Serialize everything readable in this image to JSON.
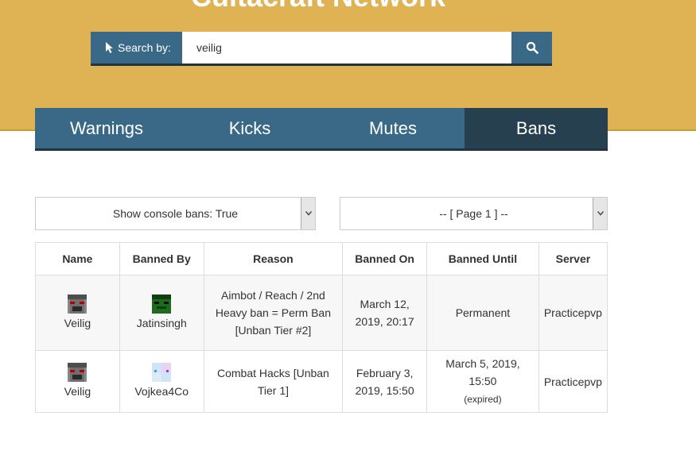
{
  "site": {
    "title": "Cultacraft Network"
  },
  "search": {
    "label": "Search by:",
    "value": "veilig"
  },
  "tabs": [
    {
      "label": "Warnings",
      "active": false
    },
    {
      "label": "Kicks",
      "active": false
    },
    {
      "label": "Mutes",
      "active": false
    },
    {
      "label": "Bans",
      "active": true
    }
  ],
  "filters": {
    "console": "Show console bans: True",
    "page": "-- [ Page 1 ] --"
  },
  "table": {
    "headers": [
      "Name",
      "Banned By",
      "Reason",
      "Banned On",
      "Banned Until",
      "Server"
    ],
    "rows": [
      {
        "name": "Veilig",
        "banned_by": "Jatinsingh",
        "reason": "Aimbot / Reach / 2nd Heavy ban = Perm Ban [Unban Tier #2]",
        "banned_on": "March 12, 2019, 20:17",
        "banned_until": "Permanent",
        "status": "",
        "server": "Practicepvp"
      },
      {
        "name": "Veilig",
        "banned_by": "Vojkea4Co",
        "reason": "Combat Hacks [Unban Tier 1]",
        "banned_on": "February 3, 2019, 15:50",
        "banned_until": "March 5, 2019, 15:50",
        "status": "(expired)",
        "server": "Practicepvp"
      }
    ]
  },
  "colors": {
    "banner": "#dfb254",
    "nav": "#3a6987",
    "nav_active": "#27404f"
  }
}
